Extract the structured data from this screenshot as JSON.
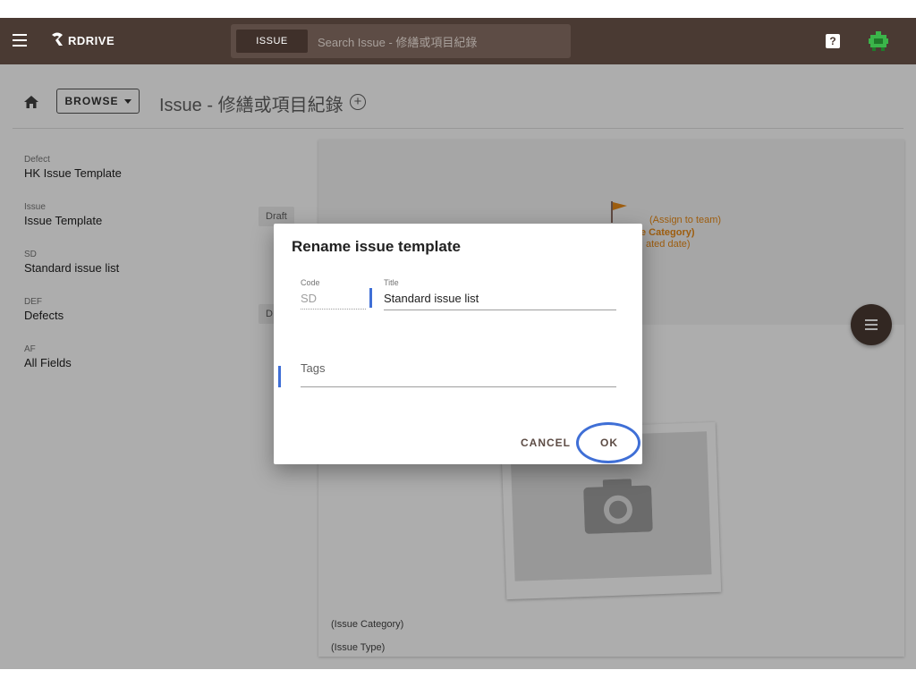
{
  "app": {
    "logo_text": "RDRIVE",
    "search_scope": "ISSUE",
    "search_placeholder": "Search Issue - 修繕或項目紀錄",
    "help_label": "?"
  },
  "header": {
    "browse_label": "BROWSE",
    "page_title": "Issue - 修繕或項目紀錄",
    "add_label": "+"
  },
  "sidebar": {
    "items": [
      {
        "code": "Defect",
        "label": "HK Issue Template"
      },
      {
        "code": "Issue",
        "label": "Issue Template",
        "tag": "Draft"
      },
      {
        "code": "SD",
        "label": "Standard issue list"
      },
      {
        "code": "DEF",
        "label": "Defects",
        "tag": "D"
      },
      {
        "code": "AF",
        "label": "All Fields"
      }
    ]
  },
  "preview": {
    "assign": "(Assign to team)",
    "category_bold": "e Category)",
    "date_partial": "ated date)",
    "footer_category": "(Issue Category)",
    "footer_type": "(Issue Type)"
  },
  "dialog": {
    "title": "Rename issue template",
    "code_label": "Code",
    "code_value": "SD",
    "title_label": "Title",
    "title_value": "Standard issue list",
    "tags_label": "Tags",
    "cancel_label": "CANCEL",
    "ok_label": "OK"
  },
  "colors": {
    "appbar": "#4a3a33",
    "accent_blue": "#3f6fd6",
    "orange": "#e88a17"
  }
}
